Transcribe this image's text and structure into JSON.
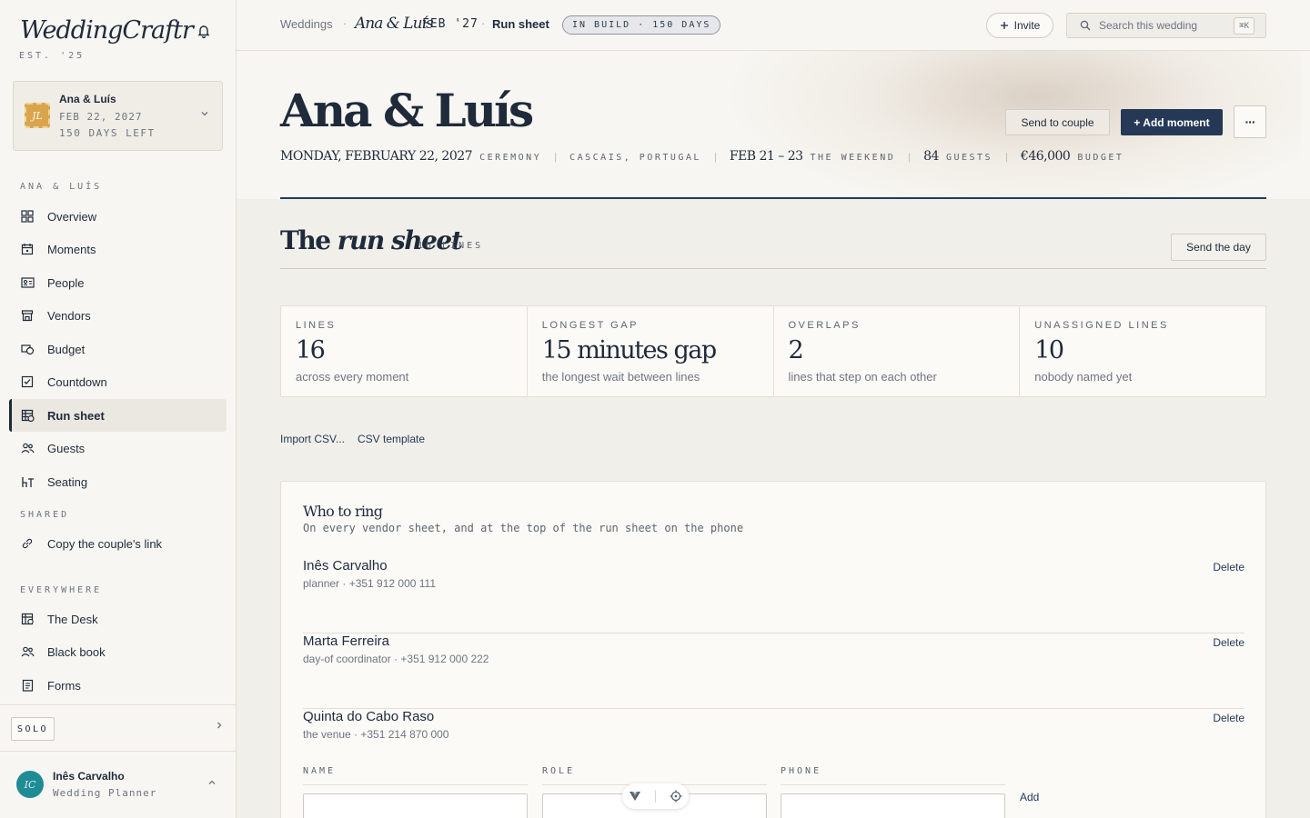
{
  "sidebar": {
    "brand": "WeddingCraftr",
    "est": "EST. '25",
    "wedding_card": {
      "badge": "JL",
      "name": "Ana & Luís",
      "date": "FEB 22, 2027",
      "days_left": "150 DAYS LEFT"
    },
    "section_couple": "ANA & LUÍS",
    "items": [
      {
        "label": "Overview",
        "icon": "grid-icon"
      },
      {
        "label": "Moments",
        "icon": "calendar-icon"
      },
      {
        "label": "People",
        "icon": "id-card-icon"
      },
      {
        "label": "Vendors",
        "icon": "storefront-icon"
      },
      {
        "label": "Budget",
        "icon": "money-icon"
      },
      {
        "label": "Countdown",
        "icon": "checkbox-icon"
      },
      {
        "label": "Run sheet",
        "icon": "run-sheet-icon",
        "active": true
      },
      {
        "label": "Guests",
        "icon": "people-icon"
      },
      {
        "label": "Seating",
        "icon": "seating-icon"
      }
    ],
    "section_shared": "SHARED",
    "shared_items": [
      {
        "label": "Copy the couple's link",
        "icon": "link-icon"
      }
    ],
    "section_everywhere": "EVERYWHERE",
    "everywhere_items": [
      {
        "label": "The Desk",
        "icon": "desk-icon"
      },
      {
        "label": "Black book",
        "icon": "contacts-icon"
      },
      {
        "label": "Forms",
        "icon": "form-icon"
      }
    ],
    "solo_label": "SOLO",
    "user": {
      "initials": "IC",
      "name": "Inês Carvalho",
      "role": "Wedding Planner"
    }
  },
  "topbar": {
    "crumb_root": "Weddings",
    "crumb_couple": "Ana & Luís",
    "crumb_date": "FEB '27",
    "crumb_page": "Run sheet",
    "build_pill": "IN BUILD · 150 DAYS",
    "invite_label": "Invite",
    "search_placeholder": "Search this wedding",
    "search_kbd": "⌘K"
  },
  "hero": {
    "title": "Ana & Luís",
    "date": "MONDAY, FEBRUARY 22, 2027",
    "date_label": "CEREMONY",
    "location": "CASCAIS, PORTUGAL",
    "weekend": "FEB 21 – 23",
    "weekend_label": "THE WEEKEND",
    "guests": "84",
    "guests_label": "GUESTS",
    "budget": "€46,000",
    "budget_label": "BUDGET",
    "send_couple_label": "Send to couple",
    "add_moment_label": "+ Add moment",
    "more_label": "···"
  },
  "run_sheet": {
    "title_plain": "The",
    "title_italic": "run sheet",
    "count": "16 LINES",
    "send_day_label": "Send the day",
    "stats": [
      {
        "label": "LINES",
        "value": "16",
        "sub": "across every moment"
      },
      {
        "label": "LONGEST GAP",
        "value": "15 minutes gap",
        "sub": "the longest wait between lines"
      },
      {
        "label": "OVERLAPS",
        "value": "2",
        "sub": "lines that step on each other"
      },
      {
        "label": "UNASSIGNED LINES",
        "value": "10",
        "sub": "nobody named yet"
      }
    ],
    "import_label": "Import CSV...",
    "template_label": "CSV template"
  },
  "who_to_ring": {
    "title": "Who to ring",
    "subtitle": "On every vendor sheet, and at the top of the run sheet on the phone",
    "delete_label": "Delete",
    "contacts": [
      {
        "name": "Inês Carvalho",
        "detail": "planner · +351 912 000 111"
      },
      {
        "name": "Marta Ferreira",
        "detail": "day-of coordinator · +351 912 000 222"
      },
      {
        "name": "Quinta do Cabo Raso",
        "detail": "the venue · +351 214 870 000"
      }
    ],
    "col_name": "NAME",
    "col_role": "ROLE",
    "col_phone": "PHONE",
    "add_label": "Add"
  }
}
